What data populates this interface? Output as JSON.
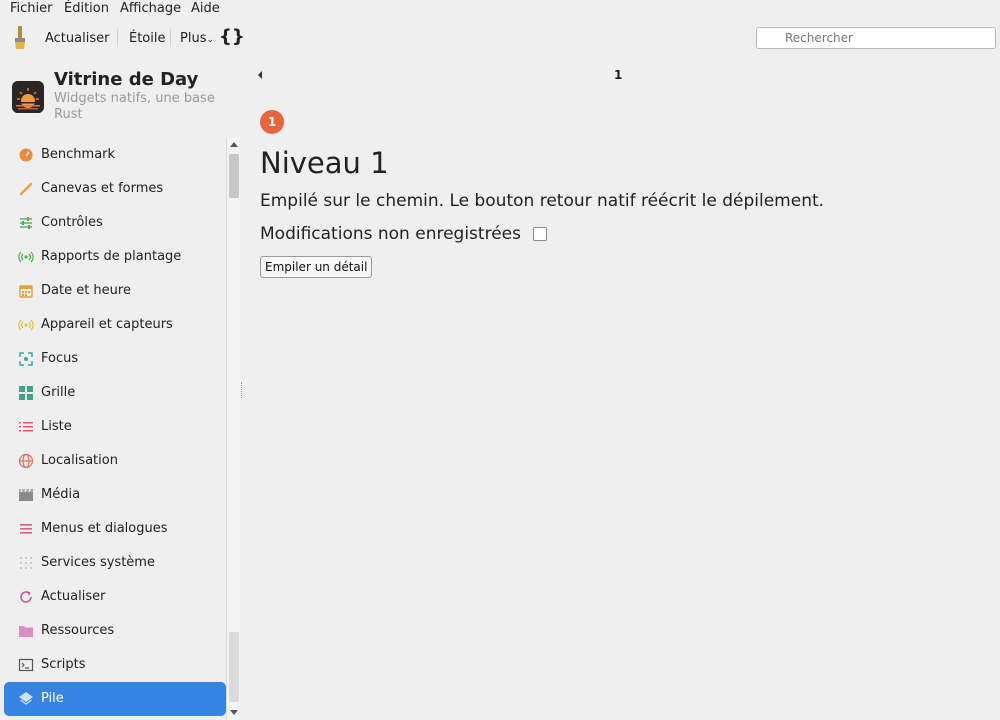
{
  "menubar": {
    "items": [
      "Fichier",
      "Édition",
      "Affichage",
      "Aide"
    ]
  },
  "toolbar": {
    "refresh_label": "Actualiser",
    "star_label": "Étoile",
    "more_label": "Plus",
    "code_icon_glyph": "{}",
    "search_placeholder": "Rechercher"
  },
  "app": {
    "title": "Vitrine de Day",
    "subtitle": "Widgets natifs, une base Rust"
  },
  "sidebar": {
    "items": [
      {
        "label": "Benchmark",
        "icon": "gauge-icon",
        "color": "#f0883e"
      },
      {
        "label": "Canevas et formes",
        "icon": "brush-icon",
        "color": "#f0a040"
      },
      {
        "label": "Contrôles",
        "icon": "sliders-icon",
        "color": "#4caf50"
      },
      {
        "label": "Rapports de plantage",
        "icon": "broadcast-icon",
        "color": "#4caf50"
      },
      {
        "label": "Date et heure",
        "icon": "calendar-icon",
        "color": "#d9a441"
      },
      {
        "label": "Appareil et capteurs",
        "icon": "sensor-icon",
        "color": "#e0c040"
      },
      {
        "label": "Focus",
        "icon": "focus-icon",
        "color": "#3fa5a5"
      },
      {
        "label": "Grille",
        "icon": "grid-icon",
        "color": "#3fa58a"
      },
      {
        "label": "Liste",
        "icon": "list-icon",
        "color": "#e05a5a"
      },
      {
        "label": "Localisation",
        "icon": "globe-icon",
        "color": "#e0705a"
      },
      {
        "label": "Média",
        "icon": "clapper-icon",
        "color": "#8a8a8a"
      },
      {
        "label": "Menus et dialogues",
        "icon": "menu-icon",
        "color": "#e05a8a"
      },
      {
        "label": "Services système",
        "icon": "dots-icon",
        "color": "#c0c0c0"
      },
      {
        "label": "Actualiser",
        "icon": "refresh-icon",
        "color": "#c05a8a"
      },
      {
        "label": "Ressources",
        "icon": "folder-icon",
        "color": "#d890c0"
      },
      {
        "label": "Scripts",
        "icon": "terminal-icon",
        "color": "#555555"
      },
      {
        "label": "Pile",
        "icon": "layers-icon",
        "color": "#ffffff",
        "selected": true
      }
    ]
  },
  "content": {
    "breadcrumb": "1",
    "badge": "1",
    "heading": "Niveau 1",
    "description": "Empilé sur le chemin. Le bouton retour natif réécrit le dépilement.",
    "unsaved_label": "Modifications non enregistrées",
    "unsaved_checked": false,
    "push_button_label": "Empiler un détail",
    "accent_color": "#e8643c",
    "selection_color": "#3584e4"
  }
}
